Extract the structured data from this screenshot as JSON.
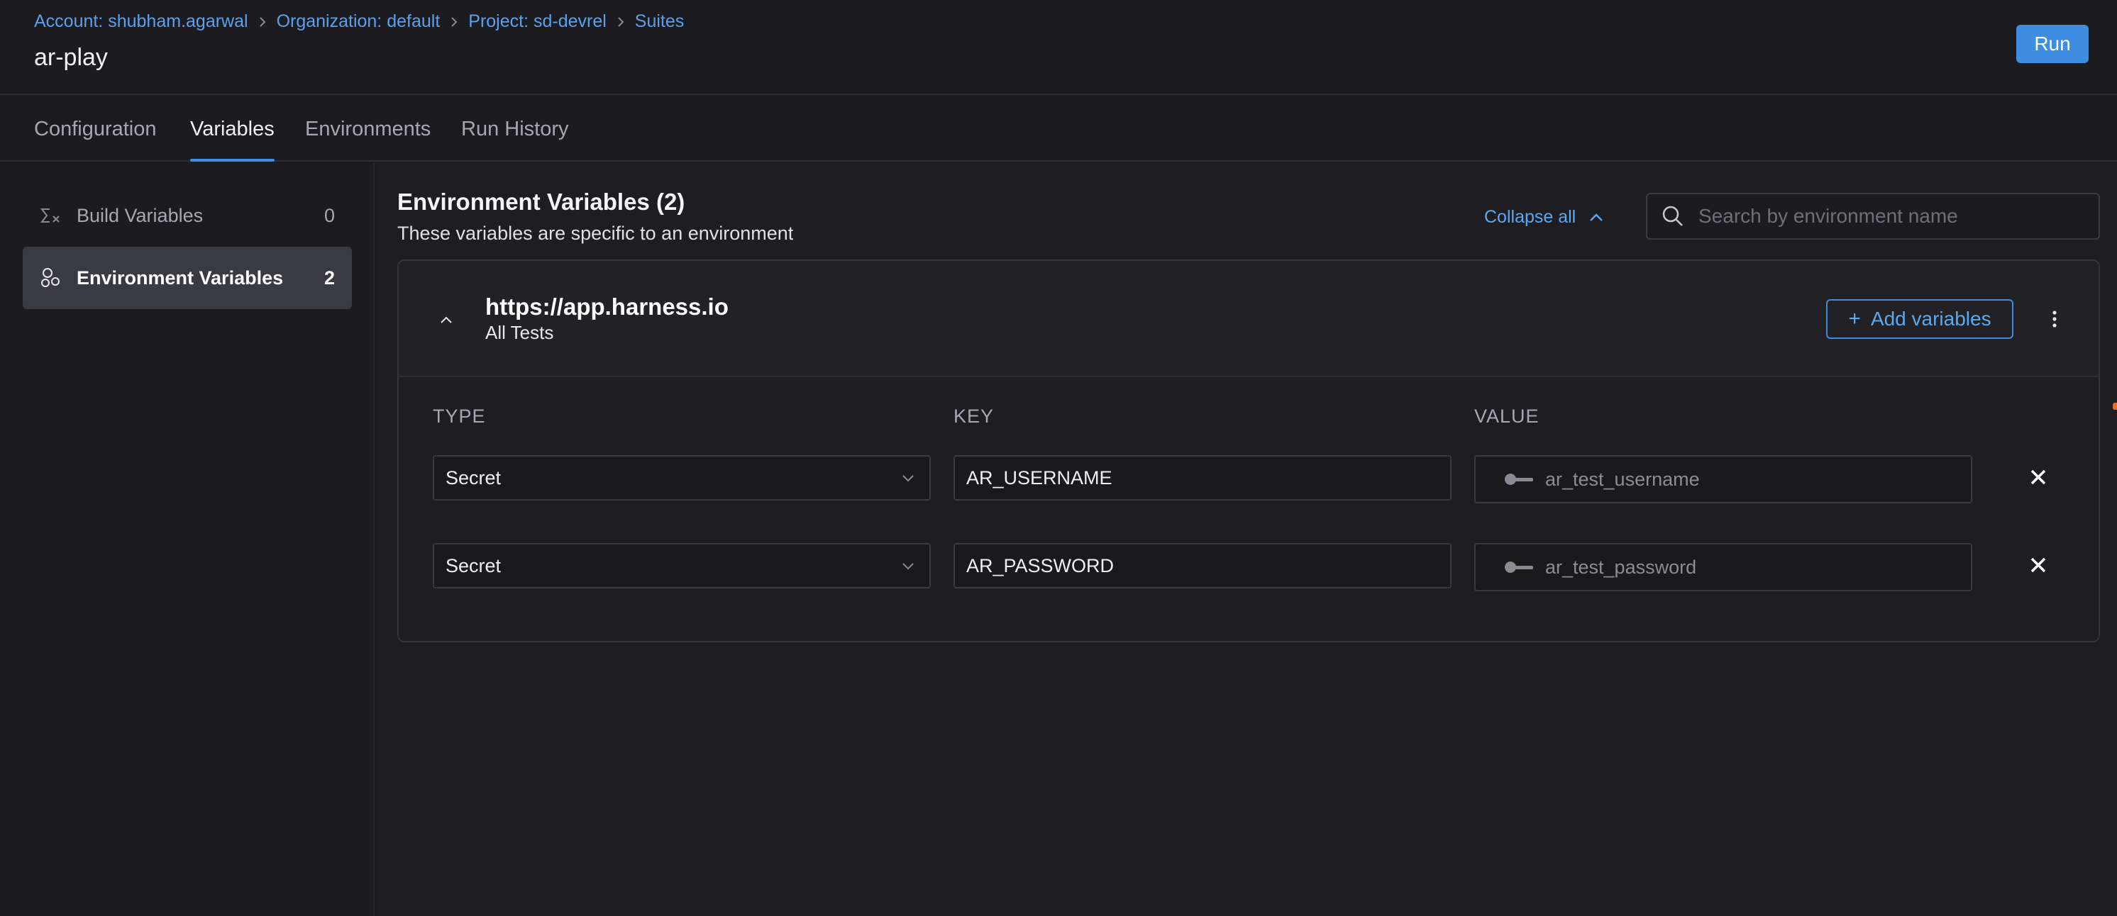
{
  "breadcrumb": [
    {
      "label": "Account: shubham.agarwal"
    },
    {
      "label": "Organization: default"
    },
    {
      "label": "Project: sd-devrel"
    },
    {
      "label": "Suites"
    }
  ],
  "page": {
    "title": "ar-play",
    "run_label": "Run"
  },
  "tabs": [
    {
      "label": "Configuration",
      "active": false
    },
    {
      "label": "Variables",
      "active": true
    },
    {
      "label": "Environments",
      "active": false
    },
    {
      "label": "Run History",
      "active": false
    }
  ],
  "sidebar": {
    "items": [
      {
        "label": "Build Variables",
        "count": "0",
        "icon": "sigma-x-icon",
        "active": false
      },
      {
        "label": "Environment Variables",
        "count": "2",
        "icon": "environment-nodes-icon",
        "active": true
      }
    ]
  },
  "main": {
    "title": "Environment Variables (2)",
    "subtitle": "These variables are specific to an environment",
    "collapse_all_label": "Collapse all",
    "search_placeholder": "Search by environment name"
  },
  "environment": {
    "name": "https://app.harness.io",
    "scope": "All Tests",
    "add_label": "Add variables",
    "columns": {
      "type": "TYPE",
      "key": "KEY",
      "value": "VALUE"
    },
    "rows": [
      {
        "type": "Secret",
        "key": "AR_USERNAME",
        "value": "ar_test_username"
      },
      {
        "type": "Secret",
        "key": "AR_PASSWORD",
        "value": "ar_test_password"
      }
    ]
  },
  "colors": {
    "accent": "#3f8de0",
    "link": "#5aa0ee",
    "background": "#1c1c20"
  }
}
